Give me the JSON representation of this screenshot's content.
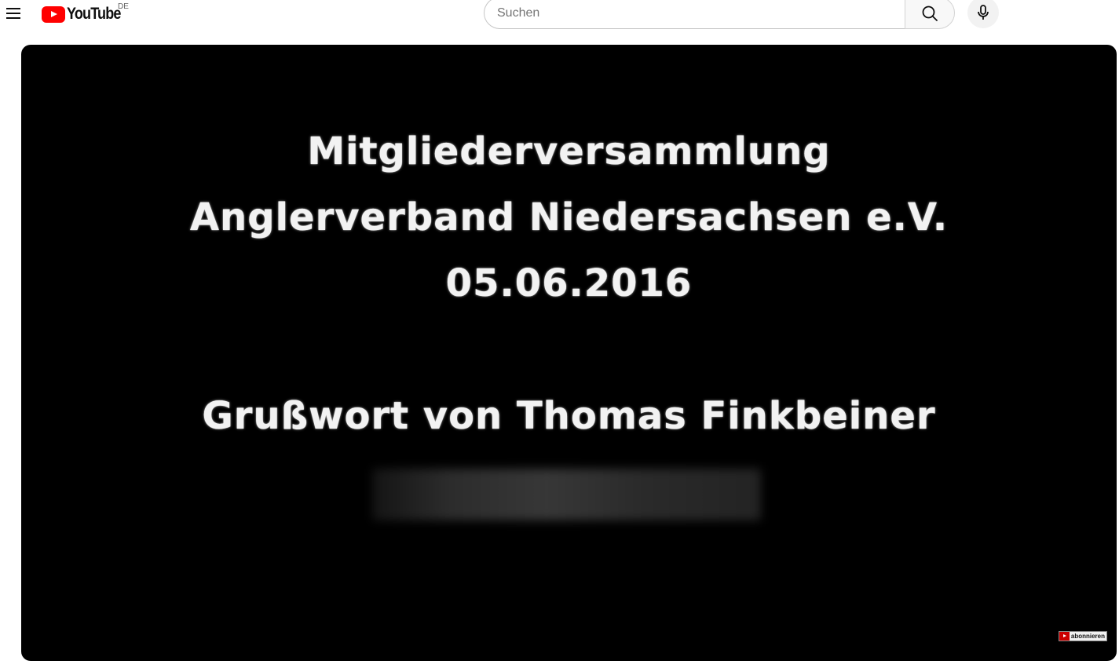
{
  "header": {
    "logo_text": "YouTube",
    "country_code": "DE",
    "search_placeholder": "Suchen",
    "search_value": ""
  },
  "video": {
    "slide_lines": [
      "Mitgliederversammlung",
      "Anglerverband Niedersachsen e.V.",
      "05.06.2016",
      "Grußwort von Thomas Finkbeiner"
    ],
    "subscribe_badge": "abonnieren"
  },
  "colors": {
    "brand_red": "#ff0000",
    "player_bg": "#000000",
    "slide_text": "#f2f2f2"
  },
  "icons": [
    "menu-icon",
    "youtube-logo-icon",
    "search-icon",
    "microphone-icon",
    "youtube-play-icon"
  ]
}
